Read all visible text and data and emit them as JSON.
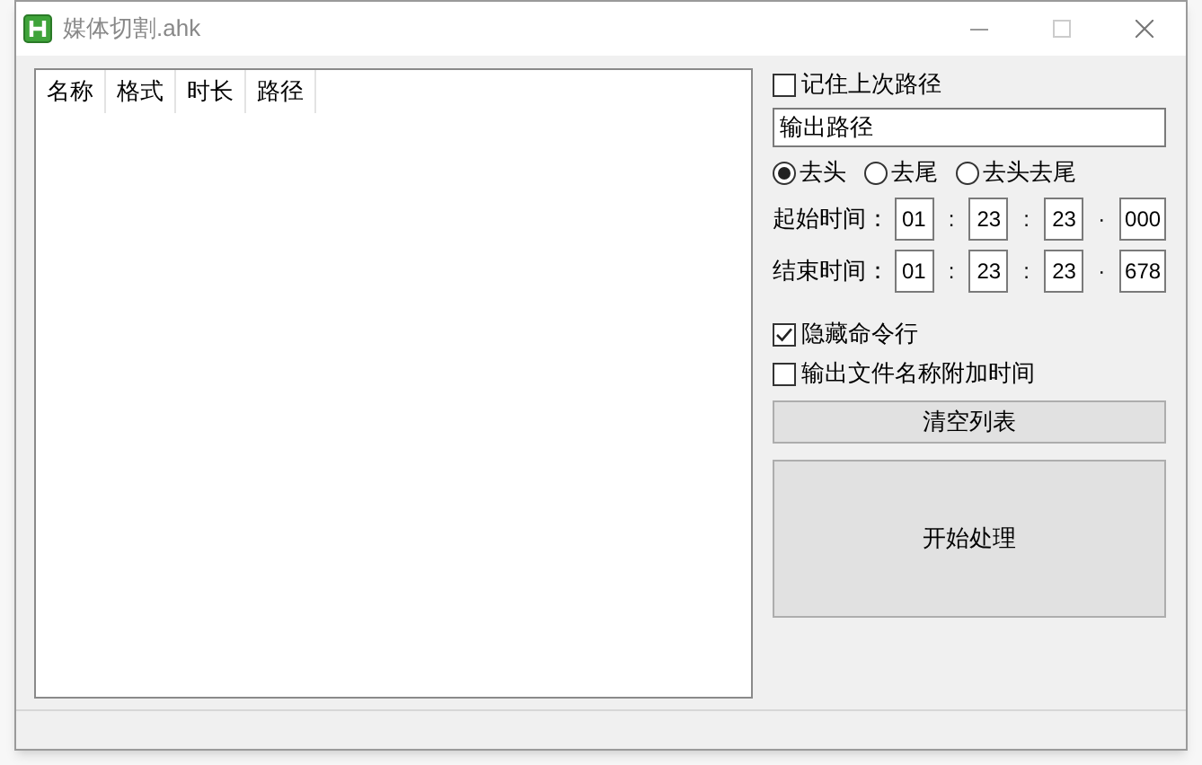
{
  "window": {
    "title": "媒体切割.ahk"
  },
  "list": {
    "columns": [
      "名称",
      "格式",
      "时长",
      "路径"
    ]
  },
  "remember_path": {
    "label": "记住上次路径",
    "checked": false
  },
  "output_path": {
    "value": "输出路径"
  },
  "modes": [
    {
      "label": "去头",
      "selected": true
    },
    {
      "label": "去尾",
      "selected": false
    },
    {
      "label": "去头去尾",
      "selected": false
    }
  ],
  "times": [
    {
      "label": "起始时间：",
      "parts": [
        "01",
        "23",
        "23",
        "000"
      ],
      "separators": [
        ":",
        ":",
        "·"
      ]
    },
    {
      "label": "结束时间：",
      "parts": [
        "01",
        "23",
        "23",
        "678"
      ],
      "separators": [
        ":",
        ":",
        "·"
      ]
    }
  ],
  "options": [
    {
      "label": "隐藏命令行",
      "checked": true
    },
    {
      "label": "输出文件名称附加时间",
      "checked": false
    }
  ],
  "buttons": [
    "清空列表",
    "开始处理"
  ]
}
